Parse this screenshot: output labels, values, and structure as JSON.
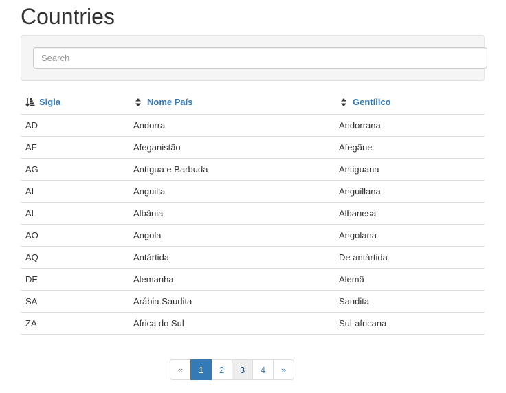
{
  "page": {
    "title": "Countries"
  },
  "search": {
    "placeholder": "Search",
    "value": ""
  },
  "table": {
    "columns": [
      {
        "label": "Sigla",
        "sort_state": "ascending",
        "sort_icon": "sort-alpha-asc-icon"
      },
      {
        "label": "Nome País",
        "sort_state": "unsorted",
        "sort_icon": "sort-icon"
      },
      {
        "label": "Gentílico",
        "sort_state": "unsorted",
        "sort_icon": "sort-icon"
      }
    ],
    "rows": [
      {
        "sigla": "AD",
        "nome": "Andorra",
        "gentilico": "Andorrana"
      },
      {
        "sigla": "AF",
        "nome": "Afeganistão",
        "gentilico": "Afegãne"
      },
      {
        "sigla": "AG",
        "nome": "Antígua e Barbuda",
        "gentilico": "Antiguana"
      },
      {
        "sigla": "AI",
        "nome": "Anguilla",
        "gentilico": "Anguillana"
      },
      {
        "sigla": "AL",
        "nome": "Albânia",
        "gentilico": "Albanesa"
      },
      {
        "sigla": "AO",
        "nome": "Angola",
        "gentilico": "Angolana"
      },
      {
        "sigla": "AQ",
        "nome": "Antártida",
        "gentilico": "De antártida"
      },
      {
        "sigla": "DE",
        "nome": "Alemanha",
        "gentilico": "Alemã"
      },
      {
        "sigla": "SA",
        "nome": "Arábia Saudita",
        "gentilico": "Saudita"
      },
      {
        "sigla": "ZA",
        "nome": "África do Sul",
        "gentilico": "Sul-africana"
      }
    ]
  },
  "pagination": {
    "prev_label": "«",
    "next_label": "»",
    "pages": [
      "1",
      "2",
      "3",
      "4"
    ],
    "active_page": "1",
    "hovered_page": "3"
  },
  "colors": {
    "link": "#337ab7",
    "active_bg": "#337ab7",
    "well_bg": "#f5f5f5",
    "border": "#dddddd"
  }
}
